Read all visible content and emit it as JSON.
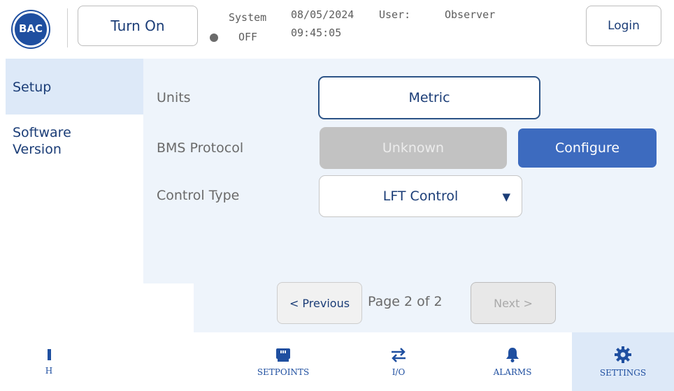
{
  "header": {
    "logo_text": "BAC",
    "turn_on_label": "Turn On",
    "system_label": "System",
    "system_state": "OFF",
    "date": "08/05/2024",
    "time": "09:45:05",
    "user_label": "User:",
    "user_value": "Observer",
    "login_label": "Login"
  },
  "sidebar": {
    "items": [
      {
        "label": "Setup",
        "active": true
      },
      {
        "label": "Software Version",
        "active": false
      }
    ]
  },
  "settings": {
    "units_label": "Units",
    "units_value": "Metric",
    "bms_label": "BMS Protocol",
    "bms_value": "Unknown",
    "configure_label": "Configure",
    "control_label": "Control Type",
    "control_value": "LFT Control"
  },
  "pagination": {
    "previous_label": "< Previous",
    "page_text": "Page 2 of 2",
    "next_label": "Next >"
  },
  "nav": {
    "home_label": "H",
    "setpoints_label": "SETPOINTS",
    "io_label": "I/O",
    "alarms_label": "ALARMS",
    "settings_label": "SETTINGS",
    "active": "SETTINGS"
  },
  "colors": {
    "brand_blue": "#1f4fa0",
    "accent": "#3d6bbf",
    "panel_bg": "#eef4fb",
    "active_bg": "#dde9f8",
    "disabled_field": "#c2c2c2"
  },
  "icons": {
    "setpoints": "module-icon",
    "io": "swap-arrows-icon",
    "alarms": "bell-icon",
    "settings": "gear-icon",
    "home": "home-icon"
  }
}
